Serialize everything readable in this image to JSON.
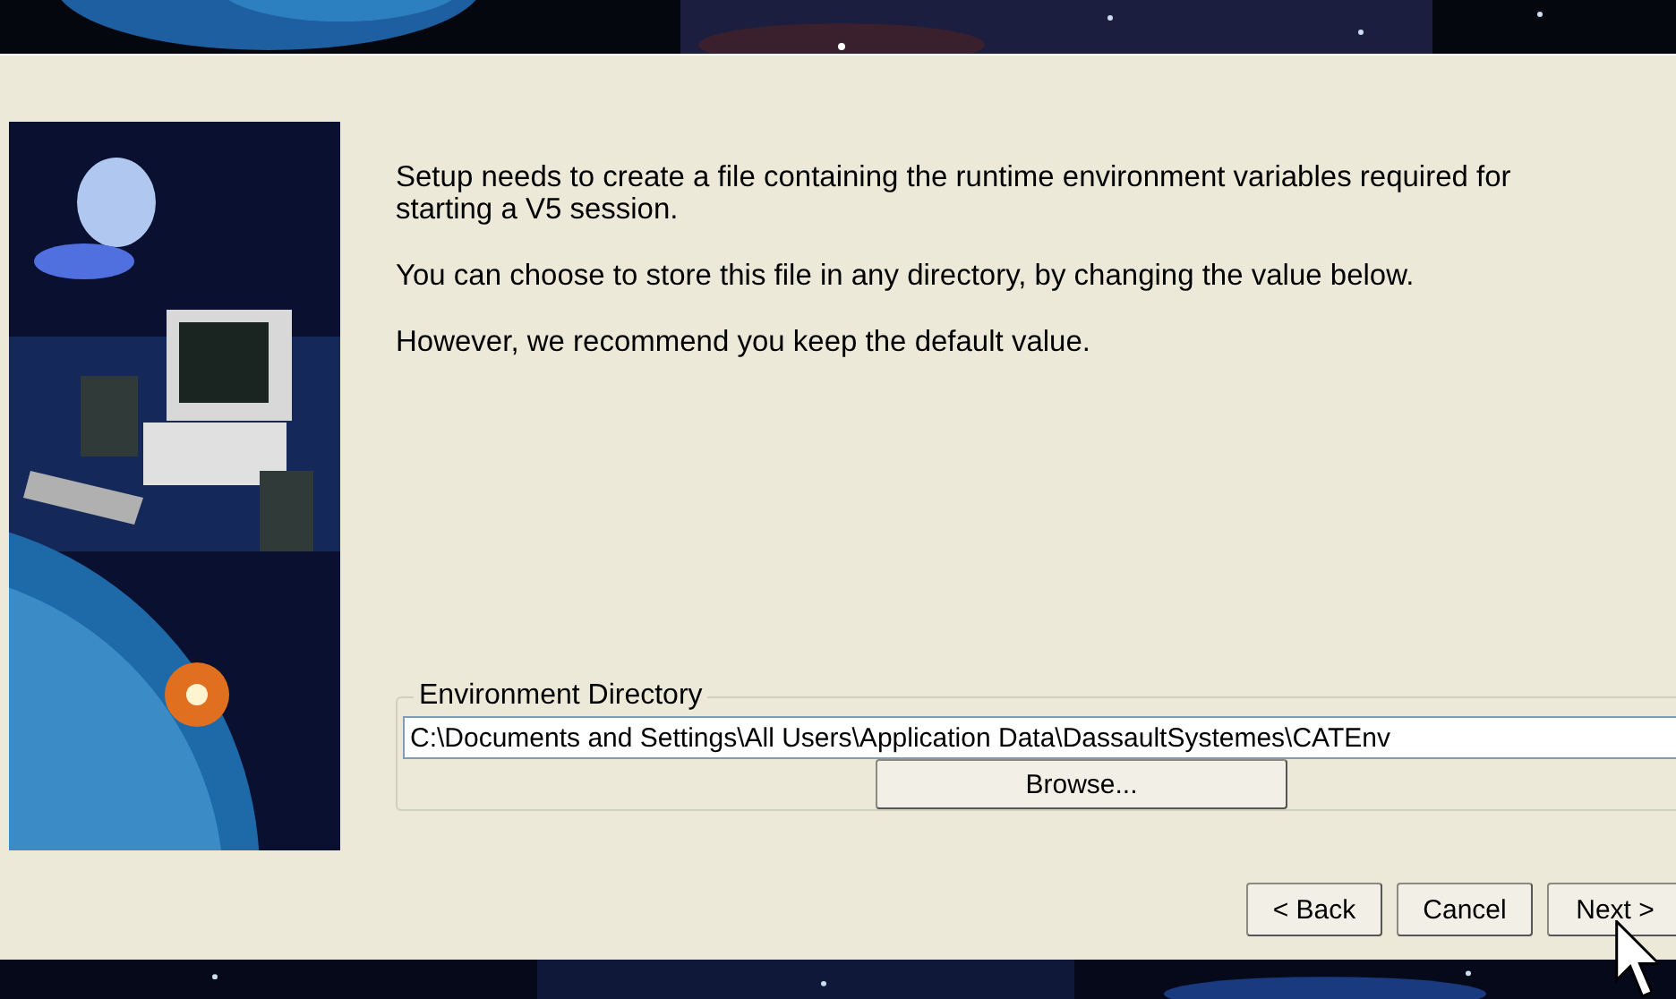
{
  "paragraphs": [
    "Setup needs to create a file containing the runtime environment variables required for starting a V5 session.",
    "You can choose to store this file in any directory, by changing the value below.",
    "However, we recommend you keep the default value."
  ],
  "environment_directory": {
    "label": "Environment Directory",
    "value": "C:\\Documents and Settings\\All Users\\Application Data\\DassaultSystemes\\CATEnv",
    "browse_button": "Browse..."
  },
  "buttons": [
    "< Back",
    "Cancel",
    "Next >"
  ]
}
